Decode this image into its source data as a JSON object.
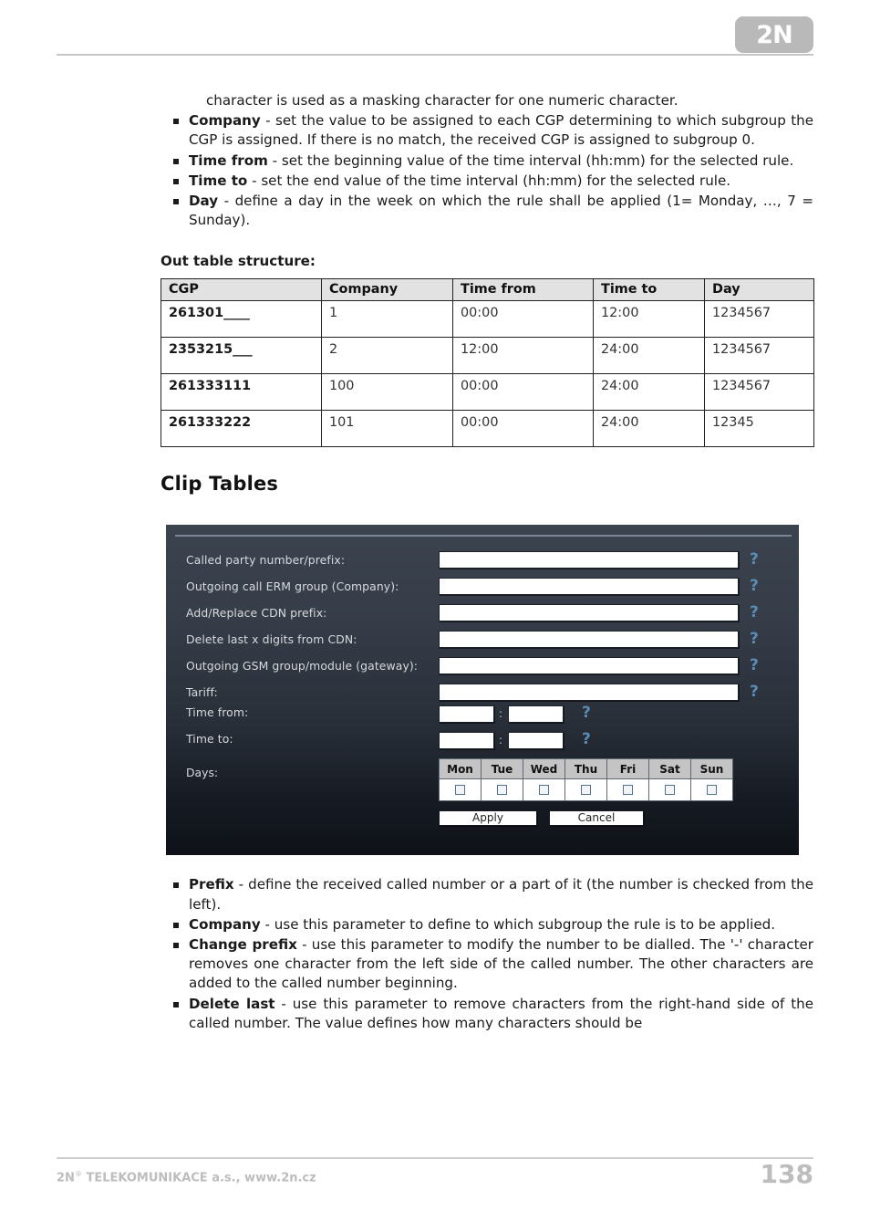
{
  "header": {
    "logo_text": "2N"
  },
  "top_list": {
    "lead_line": "character is used as a masking character for one numeric character.",
    "items": [
      {
        "term": "Company",
        "text": " - set the value to be assigned to each CGP determining to which subgroup the CGP is assigned. If there is no match, the received CGP is assigned to subgroup 0."
      },
      {
        "term": "Time from",
        "text": " - set the beginning value of the time interval (hh:mm) for the selected rule."
      },
      {
        "term": "Time to",
        "text": " - set the end value of the time interval (hh:mm) for the selected rule."
      },
      {
        "term": "Day",
        "text": " - define a day in the week on which the rule shall be applied (1= Monday, …, 7 = Sunday)."
      }
    ]
  },
  "out_table": {
    "caption": "Out table structure:",
    "columns": [
      "CGP",
      "Company",
      "Time from",
      "Time to",
      "Day"
    ],
    "rows": [
      {
        "cgp": "261301____",
        "company": "1",
        "time_from": "00:00",
        "time_to": "12:00",
        "day": "1234567"
      },
      {
        "cgp": "2353215___",
        "company": "2",
        "time_from": "12:00",
        "time_to": "24:00",
        "day": "1234567"
      },
      {
        "cgp": "261333111",
        "company": "100",
        "time_from": "00:00",
        "time_to": "24:00",
        "day": "1234567"
      },
      {
        "cgp": "261333222",
        "company": "101",
        "time_from": "00:00",
        "time_to": "24:00",
        "day": "12345"
      }
    ]
  },
  "clip_tables": {
    "heading": "Clip Tables"
  },
  "ui_panel": {
    "help_glyph": "?",
    "fields": [
      {
        "label": "Called party number/prefix:",
        "value": ""
      },
      {
        "label": "Outgoing call ERM group (Company):",
        "value": ""
      },
      {
        "label": "Add/Replace CDN prefix:",
        "value": ""
      },
      {
        "label": "Delete last x digits from CDN:",
        "value": ""
      },
      {
        "label": "Outgoing GSM group/module (gateway):",
        "value": ""
      },
      {
        "label": "Tariff:",
        "value": ""
      }
    ],
    "time_from": {
      "label": "Time from:",
      "hours": "",
      "minutes": "",
      "separator": ":"
    },
    "time_to": {
      "label": "Time to:",
      "hours": "",
      "minutes": "",
      "separator": ":"
    },
    "days": {
      "label": "Days:",
      "headers": [
        "Mon",
        "Tue",
        "Wed",
        "Thu",
        "Fri",
        "Sat",
        "Sun"
      ],
      "checked": [
        false,
        false,
        false,
        false,
        false,
        false,
        false
      ]
    },
    "buttons": {
      "apply": "Apply",
      "cancel": "Cancel"
    },
    "colors": {
      "panel_top": "#3b434f",
      "panel_bottom": "#0e1117",
      "help_icon": "#5b8cb5",
      "day_header_bg": "#c4c4c4"
    }
  },
  "bottom_list": {
    "items": [
      {
        "term": "Prefix",
        "text": " - define the received called number or a part of it (the number is checked from the left)."
      },
      {
        "term": "Company",
        "text": " - use this parameter to define to which subgroup the rule is to be applied."
      },
      {
        "term": "Change prefix",
        "text": " - use this parameter to modify the number to be dialled. The '-' character removes one character from the left side of the called number. The other characters are added to the called number beginning."
      },
      {
        "term": "Delete last",
        "text": " - use this parameter to remove characters from the right-hand side of the called number. The value defines how many characters should be"
      }
    ]
  },
  "footer": {
    "company": "2N",
    "registered_mark": "®",
    "company_rest": " TELEKOMUNIKACE a.s., www.2n.cz",
    "page_number": "138"
  }
}
